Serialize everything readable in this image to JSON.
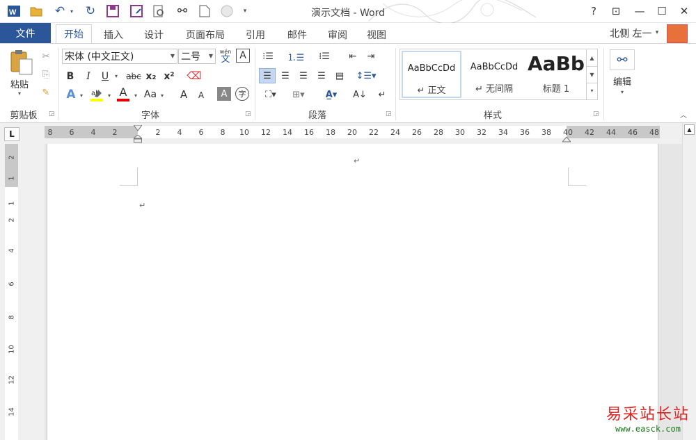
{
  "window": {
    "title": "演示文档 - Word"
  },
  "quick_access": [
    "word-logo",
    "open-folder",
    "undo",
    "redo",
    "save",
    "save-as",
    "print-preview",
    "find",
    "new-doc",
    "touch-mode",
    "customize"
  ],
  "window_buttons": {
    "help": "?",
    "ribbon_display": "⊡",
    "minimize": "—",
    "restore": "☐",
    "close": "✕"
  },
  "tabs": {
    "file": "文件",
    "items": [
      "开始",
      "插入",
      "设计",
      "页面布局",
      "引用",
      "邮件",
      "审阅",
      "视图"
    ],
    "active": "开始"
  },
  "user": {
    "name": "北侧 左一"
  },
  "ribbon": {
    "clipboard": {
      "label": "剪贴板",
      "paste": "粘贴"
    },
    "font": {
      "label": "字体",
      "font_name": "宋体 (中文正文)",
      "font_size": "二号",
      "phonetic_top": "wén",
      "phonetic_bottom": "文",
      "bold": "B",
      "italic": "I",
      "underline": "U",
      "strike": "abc",
      "subscript": "x₂",
      "superscript": "x²",
      "font_color_letter": "A",
      "case": "Aa",
      "grow": "A",
      "shrink": "A",
      "enclose": "字"
    },
    "paragraph": {
      "label": "段落"
    },
    "styles": {
      "label": "样式",
      "items": [
        {
          "sample": "AaBbCcDd",
          "name": "↵ 正文"
        },
        {
          "sample": "AaBbCcDd",
          "name": "↵ 无间隔"
        },
        {
          "sample": "AaBb",
          "name": "标题 1"
        }
      ]
    },
    "editing": {
      "label": "编辑"
    }
  },
  "ruler": {
    "corner": "L",
    "ticks": [
      "8",
      "6",
      "4",
      "2",
      "2",
      "4",
      "6",
      "8",
      "10",
      "12",
      "14",
      "16",
      "18",
      "20",
      "22",
      "24",
      "26",
      "28",
      "30",
      "32",
      "34",
      "36",
      "38",
      "40",
      "42",
      "44",
      "46",
      "48"
    ],
    "vticks": [
      "2",
      "1",
      "1",
      "2",
      "4",
      "6",
      "8",
      "10",
      "12",
      "14"
    ]
  },
  "document": {
    "paragraph_marks": [
      "↵",
      "↵"
    ]
  },
  "watermark": {
    "line1": "易采站长站",
    "line2": "www.easck.com"
  }
}
